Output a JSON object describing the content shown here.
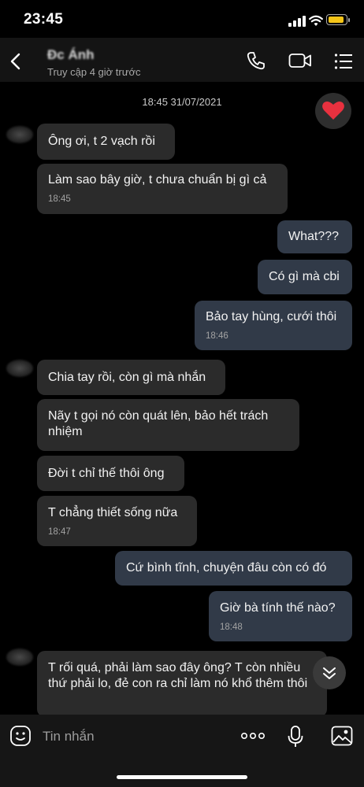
{
  "status_bar": {
    "time": "23:45"
  },
  "header": {
    "contact_name": "Đc Ánh",
    "contact_status": "Truy cập 4 giờ trước"
  },
  "chat": {
    "date_stamp": "18:45 31/07/2021",
    "messages": [
      {
        "text": "Ông ơi, t 2 vạch rồi",
        "time": ""
      },
      {
        "text": "Làm sao bây giờ, t chưa chuẩn bị gì cả",
        "time": "18:45"
      },
      {
        "text": "What???",
        "time": ""
      },
      {
        "text": "Có gì mà cbi",
        "time": ""
      },
      {
        "text": "Bảo tay hùng, cưới thôi",
        "time": "18:46"
      },
      {
        "text": "Chia tay rồi, còn gì mà nhắn",
        "time": ""
      },
      {
        "text": "Nãy t gọi nó còn quát lên, bảo hết trách nhiệm",
        "time": ""
      },
      {
        "text": "Đời t chỉ thế thôi ông",
        "time": ""
      },
      {
        "text": "T chẳng thiết sống nữa",
        "time": "18:47"
      },
      {
        "text": "Cứ bình tĩnh, chuyện đâu còn có đó",
        "time": ""
      },
      {
        "text": "Giờ bà tính thế nào?",
        "time": "18:48"
      },
      {
        "text": "T rối quá, phải làm sao đây ông? T còn nhiều thứ phải lo, đẻ con ra chỉ làm nó khổ thêm thôi",
        "time": ""
      }
    ]
  },
  "composer": {
    "placeholder": "Tin nhắn"
  },
  "colors": {
    "background": "#000000",
    "incoming_bubble": "#2b2b2b",
    "outgoing_bubble": "#313a48",
    "battery": "#f5c518",
    "heart": "#e8313f"
  },
  "icons": [
    "back-arrow-icon",
    "phone-icon",
    "video-call-icon",
    "menu-icon",
    "heart-icon",
    "chevron-down-icon",
    "sticker-icon",
    "more-icon",
    "microphone-icon",
    "image-icon"
  ]
}
